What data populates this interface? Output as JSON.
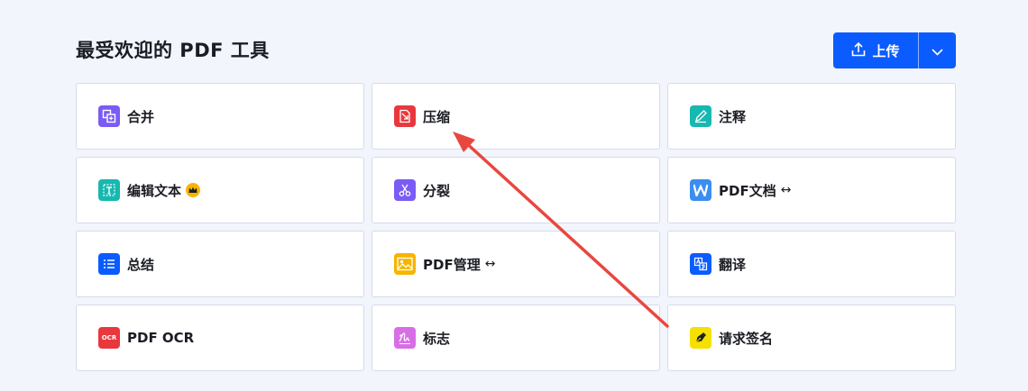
{
  "header": {
    "title": "最受欢迎的 PDF 工具",
    "upload_label": "上传"
  },
  "tools": [
    {
      "label": "合并",
      "icon": "merge-icon",
      "color": "#7a5cf5"
    },
    {
      "label": "压缩",
      "icon": "compress-icon",
      "color": "#e8383d"
    },
    {
      "label": "注释",
      "icon": "pencil-icon",
      "color": "#17b8b0"
    },
    {
      "label": "编辑文本",
      "icon": "edit-text-icon",
      "color": "#17b8b0",
      "badge": "crown-icon"
    },
    {
      "label": "分裂",
      "icon": "scissors-icon",
      "color": "#7a5cf5"
    },
    {
      "label": "PDF文档",
      "icon": "word-icon",
      "color": "#3b8ef0",
      "suffix": "↔"
    },
    {
      "label": "总结",
      "icon": "list-icon",
      "color": "#0b5cff"
    },
    {
      "label": "PDF管理",
      "icon": "image-icon",
      "color": "#f7b500",
      "suffix": "↔"
    },
    {
      "label": "翻译",
      "icon": "translate-icon",
      "color": "#0b5cff"
    },
    {
      "label": "PDF OCR",
      "icon": "ocr-icon",
      "color": "#e8383d",
      "icon_text": "OCR"
    },
    {
      "label": "标志",
      "icon": "signature-icon",
      "color": "#d86ee6"
    },
    {
      "label": "请求签名",
      "icon": "pen-nib-icon",
      "color": "#f5e000"
    }
  ],
  "colors": {
    "accent": "#0b5cff",
    "annotation_arrow": "#e8473f"
  }
}
